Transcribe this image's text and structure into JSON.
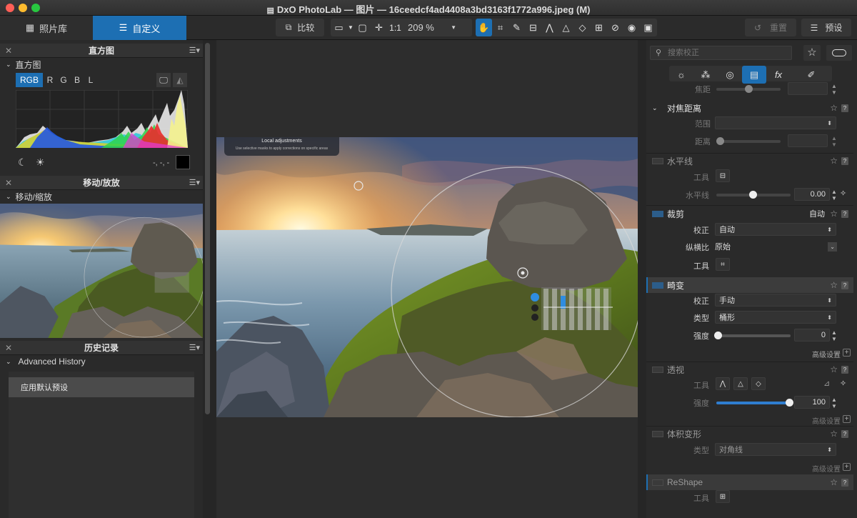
{
  "window": {
    "title": "DxO PhotoLab — 图片 — 16ceedcf4ad4408a3bd3163f1772a996.jpeg (M)"
  },
  "tabs": [
    {
      "label": "照片库",
      "icon": "grid-icon"
    },
    {
      "label": "自定义",
      "icon": "sliders-icon"
    }
  ],
  "toolbar": {
    "compare_label": "比较",
    "zoom_fit": "1:1",
    "zoom_value": "209 %",
    "reset_label": "重置",
    "preset_label": "预设"
  },
  "histogram": {
    "panel_title": "直方图",
    "section_label": "直方图",
    "channels": [
      "RGB",
      "R",
      "G",
      "B",
      "L"
    ],
    "readout": "-, -, -"
  },
  "move_zoom": {
    "panel_title": "移动/放放",
    "section_label": "移动/缩放"
  },
  "history": {
    "panel_title": "历史记录",
    "section_label": "Advanced History",
    "items": [
      "应用默认预设"
    ]
  },
  "preview": {
    "overlay_title": "Local adjustments",
    "overlay_subtitle": "Use selective masks to apply corrections on specific areas"
  },
  "right": {
    "search_placeholder": "搜索校正",
    "focus_label": "焦距",
    "focus_distance": {
      "title": "对焦距离",
      "range_label": "范围",
      "distance_label": "距离"
    },
    "horizon": {
      "title": "水平线",
      "tool_label": "工具",
      "value_label": "水平线",
      "value": "0.00"
    },
    "crop": {
      "title": "裁剪",
      "mode": "自动",
      "correct_label": "校正",
      "correct_value": "自动",
      "ratio_label": "纵横比",
      "ratio_value": "原始",
      "tool_label": "工具"
    },
    "distortion": {
      "title": "畸变",
      "correct_label": "校正",
      "correct_value": "手动",
      "type_label": "类型",
      "type_value": "桶形",
      "strength_label": "强度",
      "strength_value": "0",
      "advanced": "高级设置"
    },
    "perspective": {
      "title": "透视",
      "tool_label": "工具",
      "strength_label": "强度",
      "strength_value": "100",
      "advanced": "高级设置"
    },
    "volume": {
      "title": "体积变形",
      "type_label": "类型",
      "type_value": "对角线",
      "advanced": "高级设置"
    },
    "reshape": {
      "title": "ReShape",
      "tool_label": "工具"
    }
  },
  "colors": {
    "accent": "#1d6fb3",
    "bg": "#2a2a2a"
  }
}
